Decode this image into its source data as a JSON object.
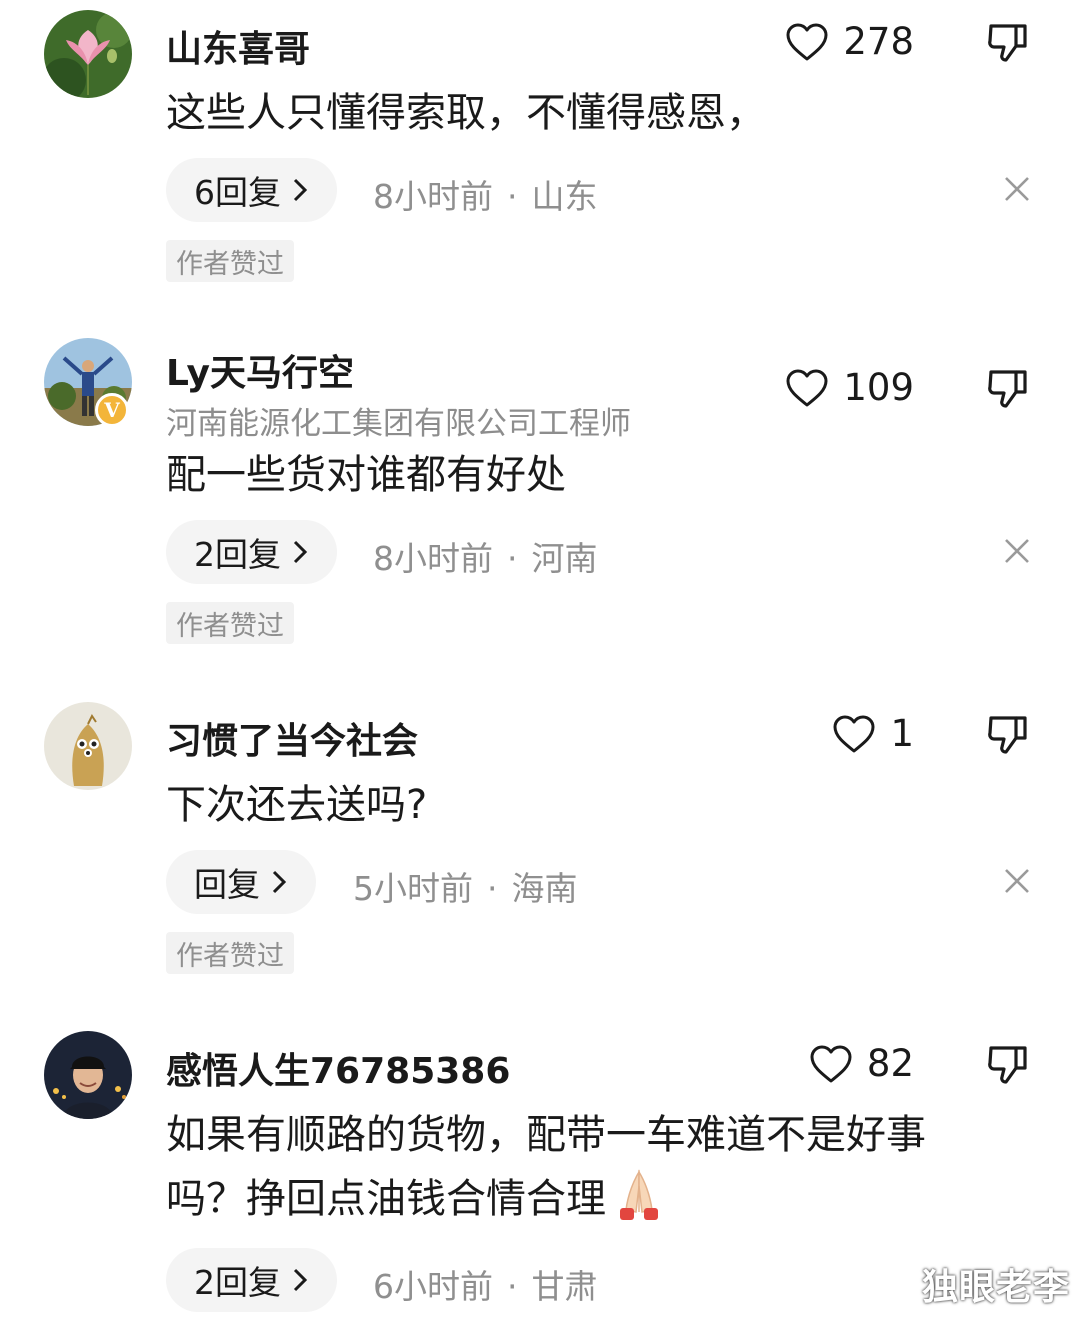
{
  "comments": [
    {
      "username": "山东喜哥",
      "text": "这些人只懂得索取，不懂得感恩，",
      "likes": "278",
      "replies": "6回复",
      "time": "8小时前",
      "location": "山东",
      "author_tag": "作者赞过"
    },
    {
      "username": "Ly天马行空",
      "title": "河南能源化工集团有限公司工程师",
      "verified_badge": "V",
      "text": "配一些货对谁都有好处",
      "likes": "109",
      "replies": "2回复",
      "time": "8小时前",
      "location": "河南",
      "author_tag": "作者赞过"
    },
    {
      "username": "习惯了当今社会",
      "text": "下次还去送吗?",
      "likes": "1",
      "replies": "回复",
      "time": "5小时前",
      "location": "海南",
      "author_tag": "作者赞过"
    },
    {
      "username": "感悟人生76785386",
      "text_line1": "如果有顺路的货物，配带一车难道不是好事",
      "text_line2": "吗？挣回点油钱合情合理",
      "likes": "82",
      "replies": "2回复",
      "time": "6小时前",
      "location": "甘肃"
    }
  ],
  "separator": "·",
  "watermark": "独眼老李",
  "icons": {
    "like": "heart-outline-icon",
    "dislike": "thumbs-down-icon",
    "close": "close-icon",
    "reply_arrow": "chevron-right-icon",
    "emoji": "folded-hands-emoji"
  },
  "colors": {
    "text": "#1a1a1a",
    "meta": "#8f8f8f",
    "pill_bg": "#f4f4f4",
    "badge": "#f3b53a"
  }
}
